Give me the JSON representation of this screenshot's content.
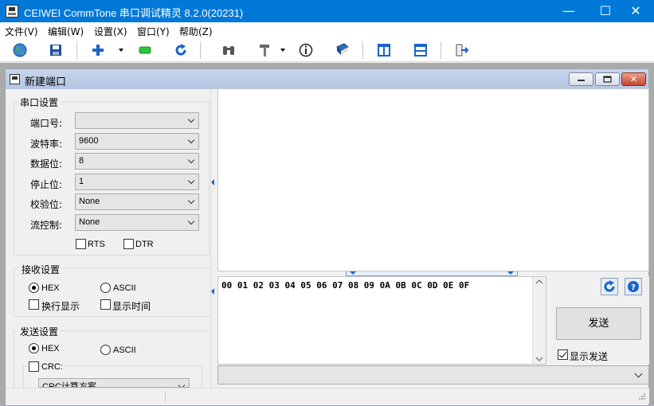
{
  "window": {
    "title": "CEIWEI CommTone 串口调试精灵 8.2.0(20231)",
    "min": "—",
    "max": "☐",
    "close": "✕"
  },
  "menu": [
    "文件(V)",
    "编辑(W)",
    "设置(X)",
    "窗口(Y)",
    "帮助(Z)"
  ],
  "child": {
    "title": "新建端口",
    "close": "✕"
  },
  "serial": {
    "group_title": "串口设置",
    "port_label": "端口号:",
    "port_value": "",
    "baud_label": "波特率:",
    "baud_value": "9600",
    "databits_label": "数据位:",
    "databits_value": "8",
    "stopbits_label": "停止位:",
    "stopbits_value": "1",
    "parity_label": "校验位:",
    "parity_value": "None",
    "flow_label": "流控制:",
    "flow_value": "None",
    "rts_label": "RTS",
    "dtr_label": "DTR"
  },
  "receive": {
    "group_title": "接收设置",
    "hex_label": "HEX",
    "ascii_label": "ASCII",
    "newline_label": "换行显示",
    "time_label": "显示时间"
  },
  "send_settings": {
    "group_title": "发送设置",
    "hex_label": "HEX",
    "ascii_label": "ASCII",
    "crc_label": "CRC:",
    "crc_combo": "CRC计算方案"
  },
  "send_area": {
    "text": "00 01 02 03 04 05 06 07 08 09 0A 0B 0C 0D 0E 0F"
  },
  "actions": {
    "send_label": "发送",
    "show_send_label": "显示发送"
  }
}
